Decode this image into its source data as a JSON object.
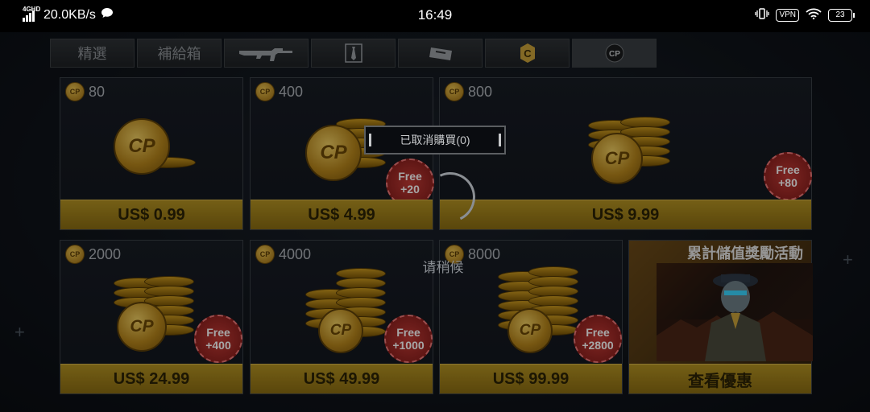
{
  "status_bar": {
    "network": "4GHD",
    "speed": "20.0KB/s",
    "time": "16:49",
    "vpn": "VPN",
    "battery": "23"
  },
  "tabs": [
    {
      "label": "精選",
      "type": "text"
    },
    {
      "label": "補給箱",
      "type": "text"
    },
    {
      "label": "",
      "type": "icon",
      "icon": "rifle-icon"
    },
    {
      "label": "",
      "type": "icon",
      "icon": "tie-icon"
    },
    {
      "label": "",
      "type": "icon",
      "icon": "ticket-icon"
    },
    {
      "label": "",
      "type": "icon",
      "icon": "c-coin-icon"
    },
    {
      "label": "",
      "type": "icon",
      "icon": "cp-icon",
      "active": true
    }
  ],
  "cp_icon_text": "CP",
  "products": [
    {
      "amount": "80",
      "price": "US$ 0.99",
      "bonus": ""
    },
    {
      "amount": "400",
      "price": "US$ 4.99",
      "bonus_label": "Free",
      "bonus": "+20"
    },
    {
      "amount": "800",
      "price": "US$ 9.99",
      "bonus_label": "Free",
      "bonus": "+80"
    },
    {
      "amount": "2000",
      "price": "US$ 24.99",
      "bonus_label": "Free",
      "bonus": "+400"
    },
    {
      "amount": "4000",
      "price": "US$ 49.99",
      "bonus_label": "Free",
      "bonus": "+1000"
    },
    {
      "amount": "8000",
      "price": "US$ 99.99",
      "bonus_label": "Free",
      "bonus": "+2800"
    }
  ],
  "promo": {
    "title": "累計儲值獎勵活動",
    "button": "查看優惠"
  },
  "toast": "已取消購買(0)",
  "loading_text": "请稍候",
  "colors": {
    "price_bar": "#a88a1e",
    "badge": "#b3302c",
    "coin": "#d4a430"
  }
}
